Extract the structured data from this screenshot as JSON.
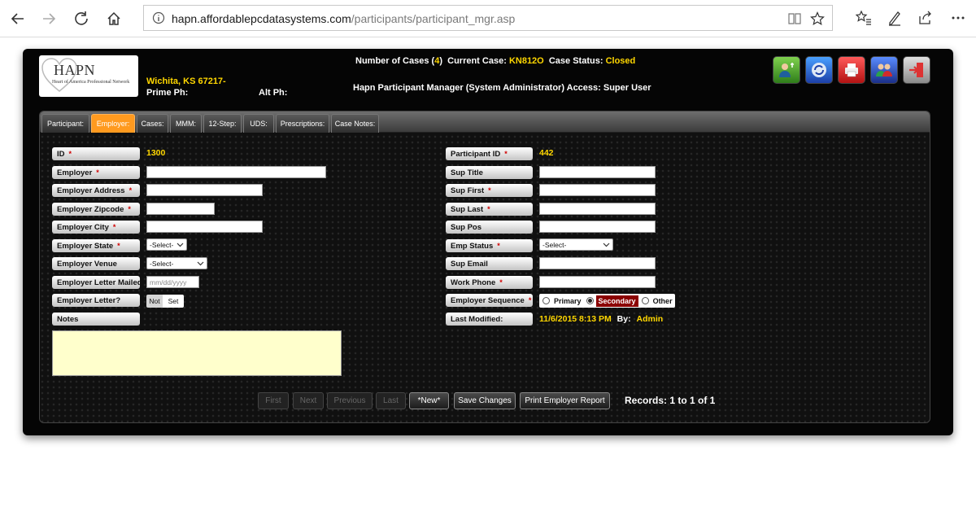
{
  "browser": {
    "url_host": "hapn.affordablepcdatasystems.com",
    "url_path": "/participants/participant_mgr.asp"
  },
  "header": {
    "logo_brand": "HAPN",
    "logo_tagline": "Heart of America Professional Network",
    "location": "Wichita, KS 67217-",
    "prime_ph_label": "Prime Ph:",
    "alt_ph_label": "Alt Ph:",
    "cases_label": "Number of Cases (",
    "cases_count": "4",
    "cases_close": ")",
    "current_case_label": "Current Case:",
    "current_case": "KN812O",
    "case_status_label": "Case Status:",
    "case_status": "Closed",
    "access_text": "Hapn Participant Manager (System Administrator) Access: Super User",
    "icons": [
      "user-info-icon",
      "refresh-icon",
      "printer-icon",
      "users-icon",
      "logout-icon"
    ]
  },
  "tabs": [
    {
      "label": "Participant:",
      "active": false
    },
    {
      "label": "Employer:",
      "active": true
    },
    {
      "label": "Cases:",
      "active": false
    },
    {
      "label": "MMM:",
      "active": false
    },
    {
      "label": "12-Step:",
      "active": false
    },
    {
      "label": "UDS:",
      "active": false
    },
    {
      "label": "Prescriptions:",
      "active": false
    },
    {
      "label": "Case Notes:",
      "active": false
    }
  ],
  "left_fields": {
    "id_label": "ID",
    "id_value": "1300",
    "employer_label": "Employer",
    "address_label": "Employer Address",
    "zip_label": "Employer Zipcode",
    "city_label": "Employer City",
    "state_label": "Employer State",
    "state_value": "-Select-",
    "venue_label": "Employer Venue",
    "venue_value": "-Select-",
    "letter_mailed_label": "Employer Letter Mailed",
    "letter_mailed_placeholder": "mm/dd/yyyy",
    "letter_label": "Employer Letter?",
    "letter_not": "Not",
    "letter_set": "Set",
    "notes_label": "Notes"
  },
  "right_fields": {
    "participant_id_label": "Participant ID",
    "participant_id_value": "442",
    "sup_title_label": "Sup Title",
    "sup_first_label": "Sup First",
    "sup_last_label": "Sup Last",
    "sup_pos_label": "Sup Pos",
    "emp_status_label": "Emp Status",
    "emp_status_value": "-Select-",
    "sup_email_label": "Sup Email",
    "work_phone_label": "Work Phone",
    "sequence_label": "Employer Sequence",
    "seq_primary": "Primary",
    "seq_secondary": "Secondary",
    "seq_other": "Other",
    "last_modified_label": "Last Modified:",
    "last_modified_value": "11/6/2015 8:13 PM",
    "by_label": "By:",
    "by_value": "Admin"
  },
  "pager": {
    "first": "First",
    "next": "Next",
    "previous": "Previous",
    "last": "Last",
    "new": "*New*",
    "save": "Save Changes",
    "print": "Print Employer Report",
    "records": "Records: 1 to 1 of 1"
  }
}
